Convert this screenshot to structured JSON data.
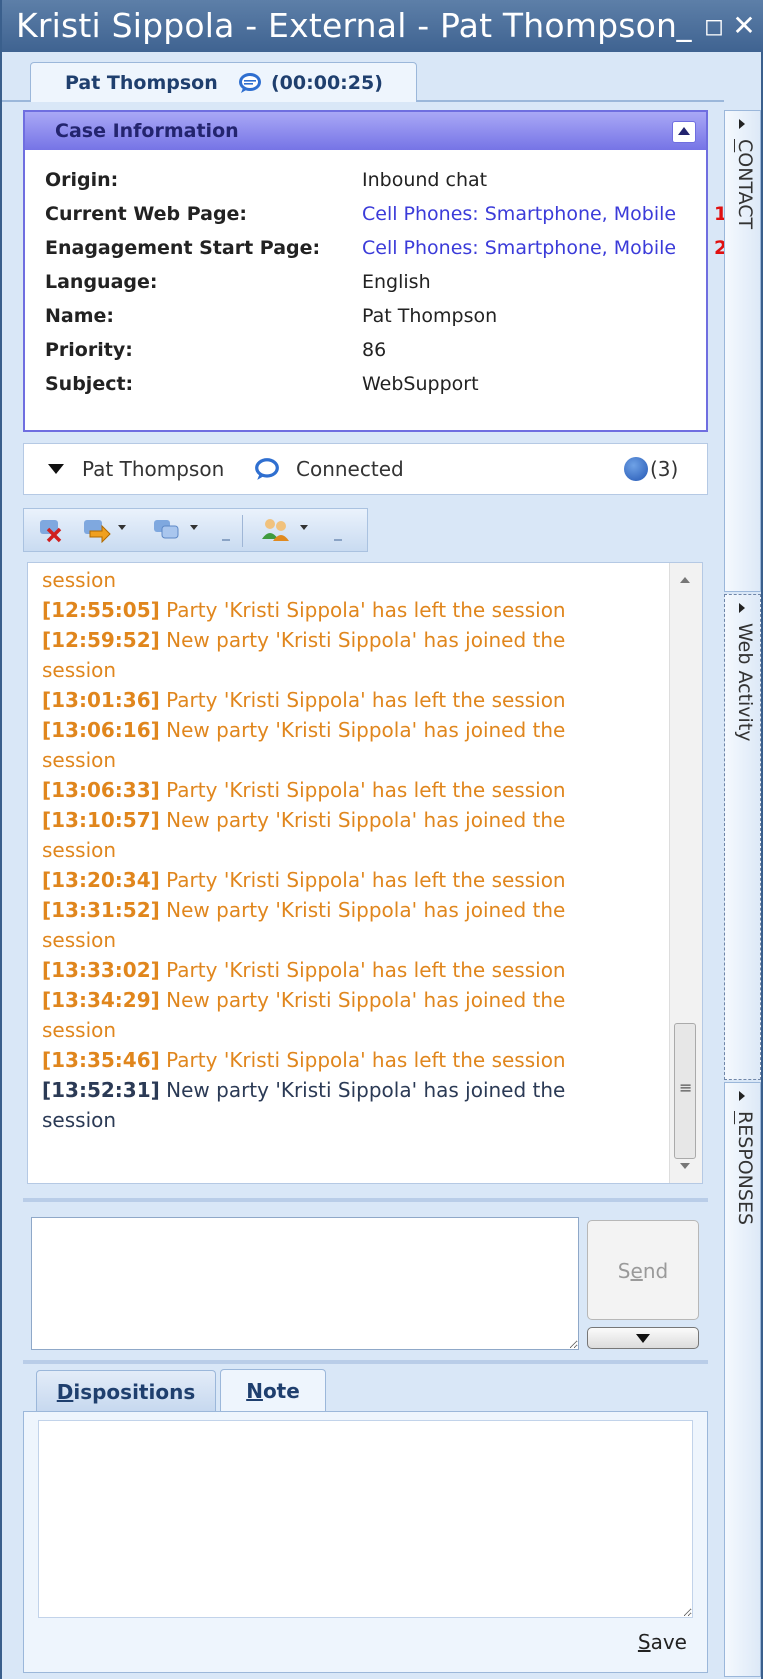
{
  "window": {
    "title": "Kristi Sippola - External - Pat Thompson",
    "minimize_glyph": "_",
    "maximize_glyph": "◻",
    "close_glyph": "✕"
  },
  "interaction_tab": {
    "name": "Pat Thompson",
    "timer": "(00:00:25)",
    "icon": "chat-bubble-icon"
  },
  "case_info": {
    "header": "Case Information",
    "rows": [
      {
        "label": "Origin:",
        "value": "Inbound chat",
        "link": false
      },
      {
        "label": "Current Web Page:",
        "value": "Cell Phones: Smartphone, Mobile",
        "link": true,
        "badge": "1"
      },
      {
        "label": "Enagagement Start Page:",
        "value": "Cell Phones: Smartphone, Mobile",
        "link": true,
        "badge": "2"
      },
      {
        "label": "Language:",
        "value": "English",
        "link": false
      },
      {
        "label": "Name:",
        "value": "Pat Thompson",
        "link": false
      },
      {
        "label": "Priority:",
        "value": "86",
        "link": false
      },
      {
        "label": "Subject:",
        "value": "WebSupport",
        "link": false
      }
    ]
  },
  "party": {
    "name": "Pat Thompson",
    "status": "Connected",
    "pending_count": "(3)"
  },
  "toolbar": {
    "icons": [
      "end-chat-icon",
      "transfer-icon",
      "conference-icon",
      "consult-icon"
    ]
  },
  "transcript": {
    "messages": [
      {
        "time": "",
        "text": "session",
        "color": "orange"
      },
      {
        "time": "[12:55:05]",
        "text": " Party 'Kristi Sippola' has left the session",
        "color": "orange"
      },
      {
        "time": "[12:59:52]",
        "text": " New party 'Kristi Sippola' has joined the",
        "color": "orange"
      },
      {
        "time": "",
        "text": "session",
        "color": "orange"
      },
      {
        "time": "[13:01:36]",
        "text": " Party 'Kristi Sippola' has left the session",
        "color": "orange"
      },
      {
        "time": "[13:06:16]",
        "text": " New party 'Kristi Sippola' has joined the",
        "color": "orange"
      },
      {
        "time": "",
        "text": "session",
        "color": "orange"
      },
      {
        "time": "[13:06:33]",
        "text": " Party 'Kristi Sippola' has left the session",
        "color": "orange"
      },
      {
        "time": "[13:10:57]",
        "text": " New party 'Kristi Sippola' has joined the",
        "color": "orange"
      },
      {
        "time": "",
        "text": "session",
        "color": "orange"
      },
      {
        "time": "[13:20:34]",
        "text": " Party 'Kristi Sippola' has left the session",
        "color": "orange"
      },
      {
        "time": "[13:31:52]",
        "text": " New party 'Kristi Sippola' has joined the",
        "color": "orange"
      },
      {
        "time": "",
        "text": "session",
        "color": "orange"
      },
      {
        "time": "[13:33:02]",
        "text": " Party 'Kristi Sippola' has left the session",
        "color": "orange"
      },
      {
        "time": "[13:34:29]",
        "text": " New party 'Kristi Sippola' has joined the",
        "color": "orange"
      },
      {
        "time": "",
        "text": "session",
        "color": "orange"
      },
      {
        "time": "[13:35:46]",
        "text": " Party 'Kristi Sippola' has left the session",
        "color": "orange"
      },
      {
        "time": "[13:52:31]",
        "text": " New party 'Kristi Sippola' has joined the",
        "color": "dark"
      },
      {
        "time": "",
        "text": "session",
        "color": "dark"
      }
    ]
  },
  "compose": {
    "value": "",
    "send_prefix": "S",
    "send_mnemonic": "e",
    "send_suffix": "nd"
  },
  "bottom_tabs": {
    "dispositions_mnemonic": "D",
    "dispositions_rest": "ispositions",
    "note_mnemonic": "N",
    "note_rest": "ote",
    "save_mnemonic": "S",
    "save_rest": "ave"
  },
  "sidebar": {
    "contact_mnemonic": "C",
    "contact_rest": "ONTACT",
    "web_activity": "Web Activity",
    "responses_mnemonic": "R",
    "responses_rest": "ESPONSES"
  },
  "colors": {
    "orange_message": "#e0861d",
    "dark_message": "#2b3a55",
    "case_header": "#7674e6",
    "link": "#3b3bd9",
    "badge": "#e01010"
  }
}
